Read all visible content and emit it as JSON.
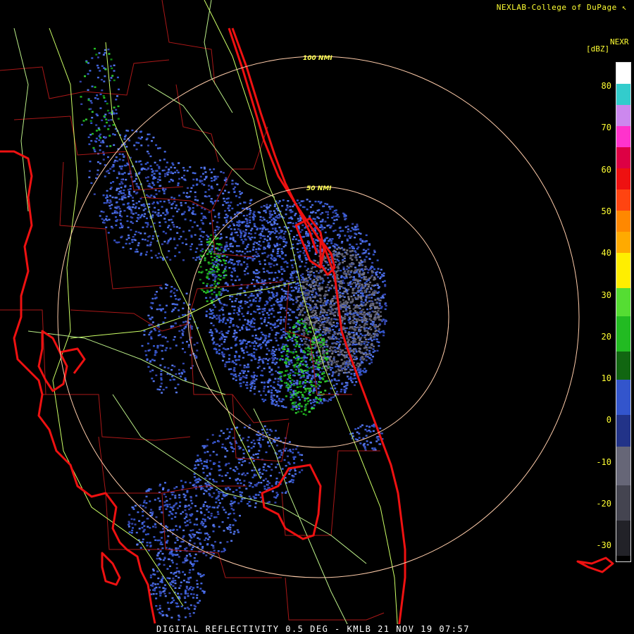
{
  "credit": "NEXLAB-College of DuPage",
  "credit_icon": "cursor-arrow-icon",
  "legend": {
    "product": "NEXR",
    "unit": "[dBZ]",
    "ticks": [
      "80",
      "70",
      "60",
      "50",
      "40",
      "30",
      "20",
      "10",
      "0",
      "-10",
      "-20",
      "-30"
    ],
    "colors": {
      "cyan": "#33cccc",
      "magenta": "#ff33cc",
      "red": "#ee1111",
      "orange": "#ff8800",
      "yellow": "#ffee00",
      "green": "#22bb22",
      "blue": "#3355cc",
      "gray": "#666677"
    }
  },
  "rings": {
    "inner": "50 NMI",
    "outer": "100 NMI"
  },
  "caption": "DIGITAL REFLECTIVITY 0.5 DEG - KMLB 21 NOV 19 07:57"
}
